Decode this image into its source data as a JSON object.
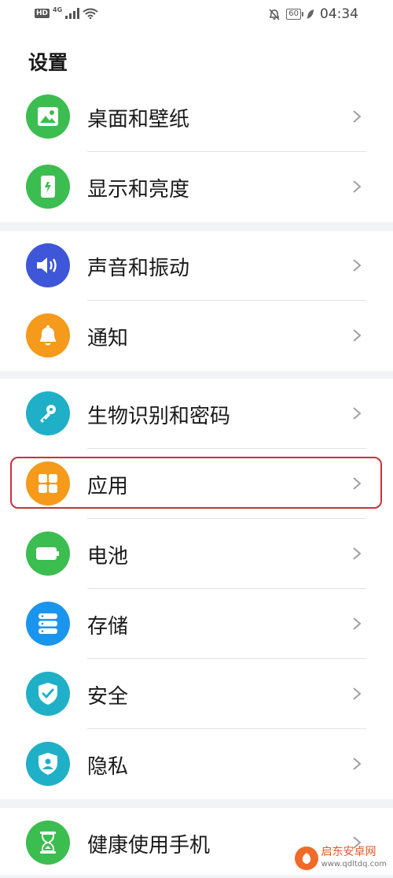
{
  "status_bar": {
    "hd": "HD",
    "network": "4G",
    "battery": "60",
    "time": "04:34"
  },
  "page": {
    "title": "设置"
  },
  "groups": [
    {
      "items": [
        {
          "label": "桌面和壁纸",
          "icon": "wallpaper-icon",
          "color": "#3bbd4f"
        },
        {
          "label": "显示和亮度",
          "icon": "display-brightness-icon",
          "color": "#3bbd4f"
        }
      ]
    },
    {
      "items": [
        {
          "label": "声音和振动",
          "icon": "sound-icon",
          "color": "#3e56d8"
        },
        {
          "label": "通知",
          "icon": "notification-bell-icon",
          "color": "#f59a1b"
        }
      ]
    },
    {
      "items": [
        {
          "label": "生物识别和密码",
          "icon": "key-icon",
          "color": "#1fb0c7"
        },
        {
          "label": "应用",
          "icon": "apps-grid-icon",
          "color": "#f59a1b",
          "highlighted": true
        },
        {
          "label": "电池",
          "icon": "battery-icon",
          "color": "#3bbd4f"
        },
        {
          "label": "存储",
          "icon": "storage-icon",
          "color": "#1a95ee"
        },
        {
          "label": "安全",
          "icon": "shield-check-icon",
          "color": "#1fb0c7"
        },
        {
          "label": "隐私",
          "icon": "privacy-shield-icon",
          "color": "#1fb0c7"
        }
      ]
    },
    {
      "items": [
        {
          "label": "健康使用手机",
          "icon": "hourglass-icon",
          "color": "#3bbd4f"
        }
      ]
    }
  ],
  "watermark": {
    "name": "启东安卓网",
    "url": "www.qdltdq.com"
  }
}
